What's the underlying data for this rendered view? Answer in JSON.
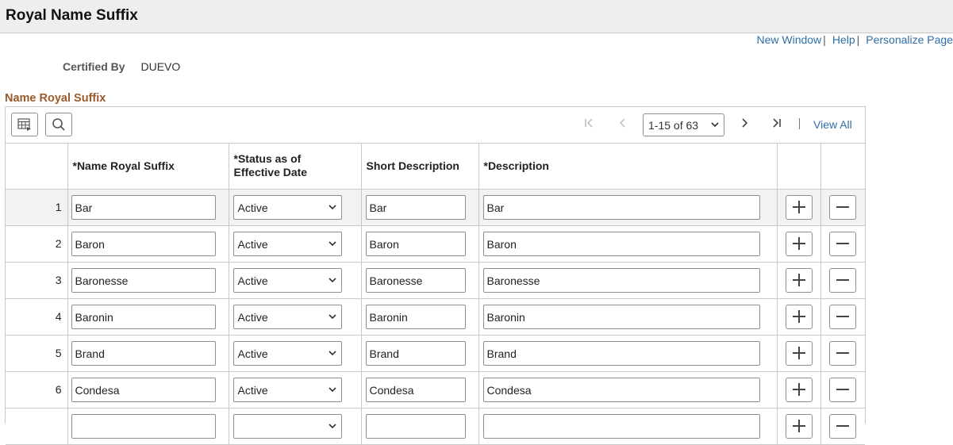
{
  "page": {
    "title": "Royal Name Suffix"
  },
  "links": {
    "new_window": "New Window",
    "help": "Help",
    "personalize": "Personalize Page"
  },
  "certified": {
    "label": "Certified By",
    "value": "DUEVO"
  },
  "grid": {
    "title": "Name Royal Suffix",
    "pager_value": "1-15 of 63",
    "view_all": "View All",
    "columns": {
      "suffix": "*Name Royal Suffix",
      "status_1": "*Status as of",
      "status_2": "Effective Date",
      "short_desc": "Short Description",
      "desc": "*Description"
    },
    "rows": [
      {
        "num": "1",
        "suffix": "Bar",
        "status": "Active",
        "short": "Bar",
        "desc": "Bar"
      },
      {
        "num": "2",
        "suffix": "Baron",
        "status": "Active",
        "short": "Baron",
        "desc": "Baron"
      },
      {
        "num": "3",
        "suffix": "Baronesse",
        "status": "Active",
        "short": "Baronesse",
        "desc": "Baronesse"
      },
      {
        "num": "4",
        "suffix": "Baronin",
        "status": "Active",
        "short": "Baronin",
        "desc": "Baronin"
      },
      {
        "num": "5",
        "suffix": "Brand",
        "status": "Active",
        "short": "Brand",
        "desc": "Brand"
      },
      {
        "num": "6",
        "suffix": "Condesa",
        "status": "Active",
        "short": "Condesa",
        "desc": "Condesa"
      },
      {
        "num": "",
        "suffix": "",
        "status": "",
        "short": "",
        "desc": ""
      }
    ]
  },
  "icons": {
    "grid_settings": "table-settings-icon",
    "search": "search-icon",
    "first": "first-page-icon",
    "prev": "previous-page-icon",
    "next": "next-page-icon",
    "last": "last-page-icon",
    "add": "plus-icon",
    "delete": "minus-icon"
  },
  "colors": {
    "link": "#2f6ea7",
    "section_title": "#9a5a2c",
    "header_bg": "#efeeee"
  }
}
